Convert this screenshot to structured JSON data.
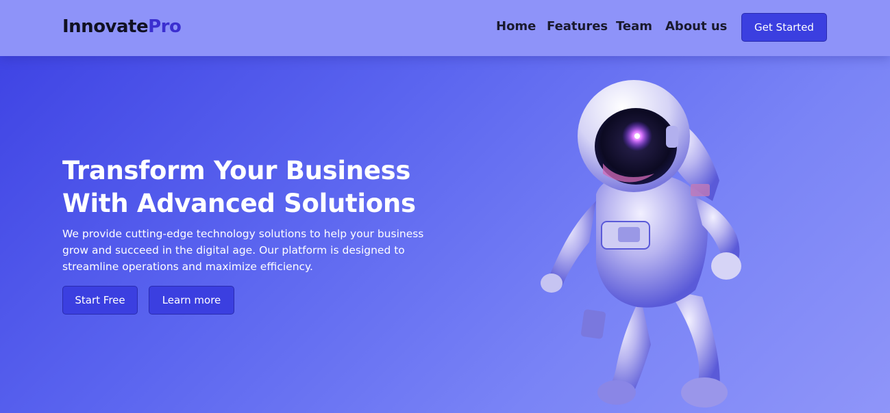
{
  "header": {
    "logo_main": "Innovate",
    "logo_accent": "Pro",
    "nav": [
      "Home",
      "Features",
      "Team",
      "About us"
    ],
    "cta_label": "Get Started"
  },
  "hero": {
    "title_line1": "Transform Your Business",
    "title_line2": "With Advanced Solutions",
    "description": "We provide cutting-edge technology solutions to help your business grow and succeed in the digital age. Our platform is designed to streamline operations and maximize efficiency.",
    "primary_button": "Start Free",
    "secondary_button": "Learn more",
    "illustration": "astronaut-illustration"
  },
  "colors": {
    "nav_bg": "#8e93f9",
    "accent": "#3b2fd0",
    "button_bg": "#3b3fe0",
    "hero_gradient_start": "#3f44e4",
    "hero_gradient_end": "#8f95f9"
  }
}
